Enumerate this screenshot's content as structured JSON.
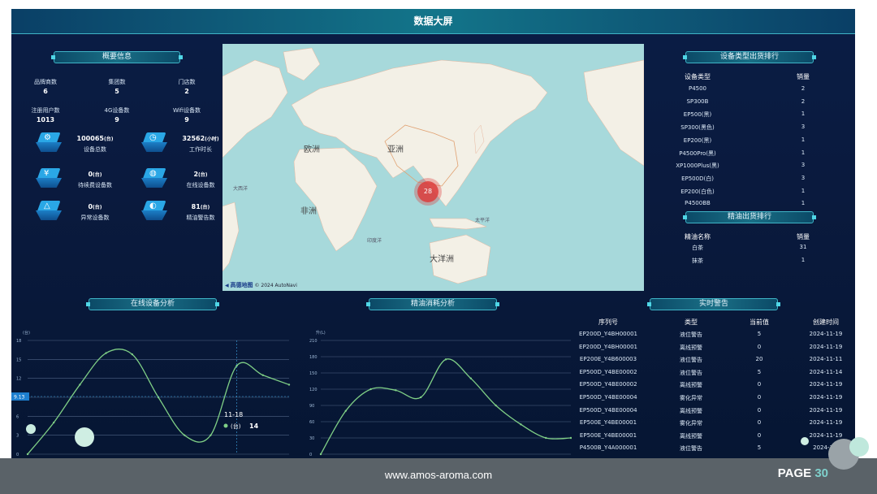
{
  "title": "数据大屏",
  "sections": {
    "overview": "概要信息",
    "device_rank": "设备类型出货排行",
    "oil_rank": "精油出货排行",
    "online": "在线设备分析",
    "oil_consume": "精油消耗分析",
    "alerts": "实时警告"
  },
  "overview": {
    "stats": [
      {
        "label": "品牌商数",
        "value": "6"
      },
      {
        "label": "集团数",
        "value": "5"
      },
      {
        "label": "门店数",
        "value": "2"
      },
      {
        "label": "注册用户数",
        "value": "1013"
      },
      {
        "label": "4G设备数",
        "value": "9"
      },
      {
        "label": "Wifi设备数",
        "value": "9"
      }
    ],
    "tiles": [
      {
        "icon": "gear-icon",
        "glyph": "⚙",
        "value": "100065",
        "unit": "(台)",
        "label": "设备总数"
      },
      {
        "icon": "clock-icon",
        "glyph": "◷",
        "value": "32562",
        "unit": "(小时)",
        "label": "工作时长"
      },
      {
        "icon": "yen-icon",
        "glyph": "¥",
        "value": "0",
        "unit": "(台)",
        "label": "待续费设备数"
      },
      {
        "icon": "globe-icon",
        "glyph": "◍",
        "value": "2",
        "unit": "(台)",
        "label": "在线设备数"
      },
      {
        "icon": "warning-icon",
        "glyph": "△",
        "value": "0",
        "unit": "(台)",
        "label": "异常设备数"
      },
      {
        "icon": "drop-icon",
        "glyph": "◐",
        "value": "81",
        "unit": "(台)",
        "label": "精油警告数"
      }
    ]
  },
  "map": {
    "labels": {
      "europe": "欧洲",
      "asia": "亚洲",
      "africa": "非洲",
      "oceania": "大洋洲",
      "atlantic": "大西洋",
      "indian": "印度洋",
      "pacific": "太平洋"
    },
    "cluster_count": "28",
    "attribution_brand": "高德地图",
    "attribution_text": "© 2024 AutoNavi"
  },
  "device_rank": {
    "headers": [
      "设备类型",
      "销量"
    ],
    "rows": [
      [
        "P4500",
        "2"
      ],
      [
        "SP300B",
        "2"
      ],
      [
        "EP500(黑)",
        "1"
      ],
      [
        "SP300(黑色)",
        "3"
      ],
      [
        "EP200(黑)",
        "1"
      ],
      [
        "P4500Pro(黑)",
        "1"
      ],
      [
        "XP1000Plus(黑)",
        "3"
      ],
      [
        "EP500D(白)",
        "3"
      ],
      [
        "EP200(白色)",
        "1"
      ],
      [
        "P4500BB",
        "1"
      ]
    ]
  },
  "oil_rank": {
    "headers": [
      "精油名称",
      "销量"
    ],
    "rows": [
      [
        "白茶",
        "31"
      ],
      [
        "抹茶",
        "1"
      ]
    ]
  },
  "alerts": {
    "headers": [
      "序列号",
      "类型",
      "当前值",
      "创建时间"
    ],
    "rows": [
      [
        "EP200D_Y4BH00001",
        "液位警告",
        "5",
        "2024-11-19"
      ],
      [
        "EP200D_Y4BH00001",
        "离线预警",
        "0",
        "2024-11-19"
      ],
      [
        "EP200E_Y4B600003",
        "液位警告",
        "20",
        "2024-11-11"
      ],
      [
        "EP500D_Y4BE00002",
        "液位警告",
        "5",
        "2024-11-14"
      ],
      [
        "EP500D_Y4BE00002",
        "离线预警",
        "0",
        "2024-11-19"
      ],
      [
        "EP500D_Y4BE00004",
        "雾化异常",
        "0",
        "2024-11-19"
      ],
      [
        "EP500D_Y4BE00004",
        "离线预警",
        "0",
        "2024-11-19"
      ],
      [
        "EP500E_Y4BE00001",
        "雾化异常",
        "0",
        "2024-11-19"
      ],
      [
        "EP500E_Y4BE00001",
        "离线预警",
        "0",
        "2024-11-19"
      ],
      [
        "P4500B_Y4A000001",
        "液位警告",
        "5",
        "2024-11-"
      ]
    ]
  },
  "chart_data": [
    {
      "type": "line",
      "unit_label": "(台)",
      "ylim": [
        0,
        18
      ],
      "yticks": [
        "18",
        "15",
        "12",
        "9",
        "6",
        "3",
        "0"
      ],
      "y": [
        0,
        5,
        11,
        16,
        15.8,
        9,
        3,
        3,
        14,
        12.5,
        11
      ],
      "marker_value": "9.13",
      "tooltip": {
        "date": "11-18",
        "unit": "(台)",
        "value": "14"
      },
      "color": "#7fcf86"
    },
    {
      "type": "line",
      "unit_label": "升(L)",
      "ylim": [
        0,
        210
      ],
      "yticks": [
        "210",
        "180",
        "150",
        "120",
        "90",
        "60",
        "30",
        "0"
      ],
      "y": [
        0,
        80,
        120,
        118,
        105,
        175,
        140,
        90,
        55,
        30,
        30
      ],
      "color": "#7fcf86"
    }
  ],
  "footer": {
    "site": "www.amos-aroma.com",
    "page_prefix": "PAGE",
    "page_num": "30"
  }
}
